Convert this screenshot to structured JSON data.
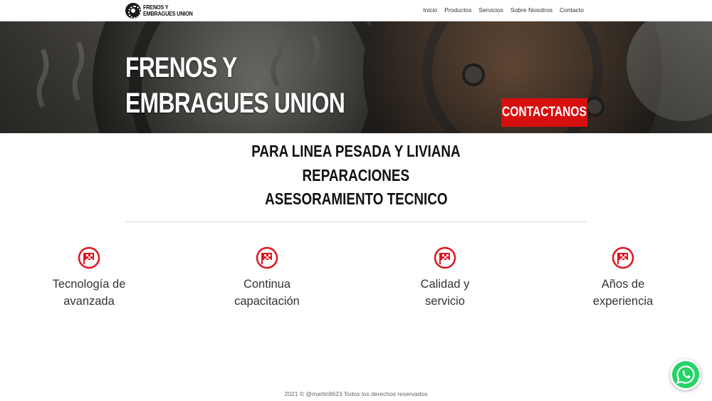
{
  "header": {
    "logo": {
      "line1": "FRENOS Y",
      "line2": "EMBRAGUES UNION",
      "icon": "brake-disc-icon"
    },
    "nav": [
      "Inicio",
      "Productos",
      "Servicios",
      "Sobre Nosotros",
      "Contacto"
    ]
  },
  "hero": {
    "title_line1": "FRENOS Y",
    "title_line2": "EMBRAGUES UNION",
    "cta_label": "CONTACTANOS",
    "cta_color": "#d80f0f"
  },
  "taglines": [
    "PARA LINEA PESADA Y LIVIANA",
    "REPARACIONES",
    "ASESORAMIENTO TECNICO"
  ],
  "features": [
    {
      "icon": "checkered-flag-icon",
      "line1": "Tecnología de",
      "line2": "avanzada"
    },
    {
      "icon": "checkered-flag-icon",
      "line1": "Continua",
      "line2": "capacitación"
    },
    {
      "icon": "checkered-flag-icon",
      "line1": "Calidad y",
      "line2": "servicio"
    },
    {
      "icon": "checkered-flag-icon",
      "line1": "Años de",
      "line2": "experiencia"
    }
  ],
  "footer": {
    "text": "2021 © @martin9623 Todos los derechos reservados"
  },
  "whatsapp": {
    "icon": "whatsapp-icon",
    "color": "#25d366"
  },
  "colors": {
    "accent": "#d80f0f",
    "icon_red": "#e0141e"
  }
}
